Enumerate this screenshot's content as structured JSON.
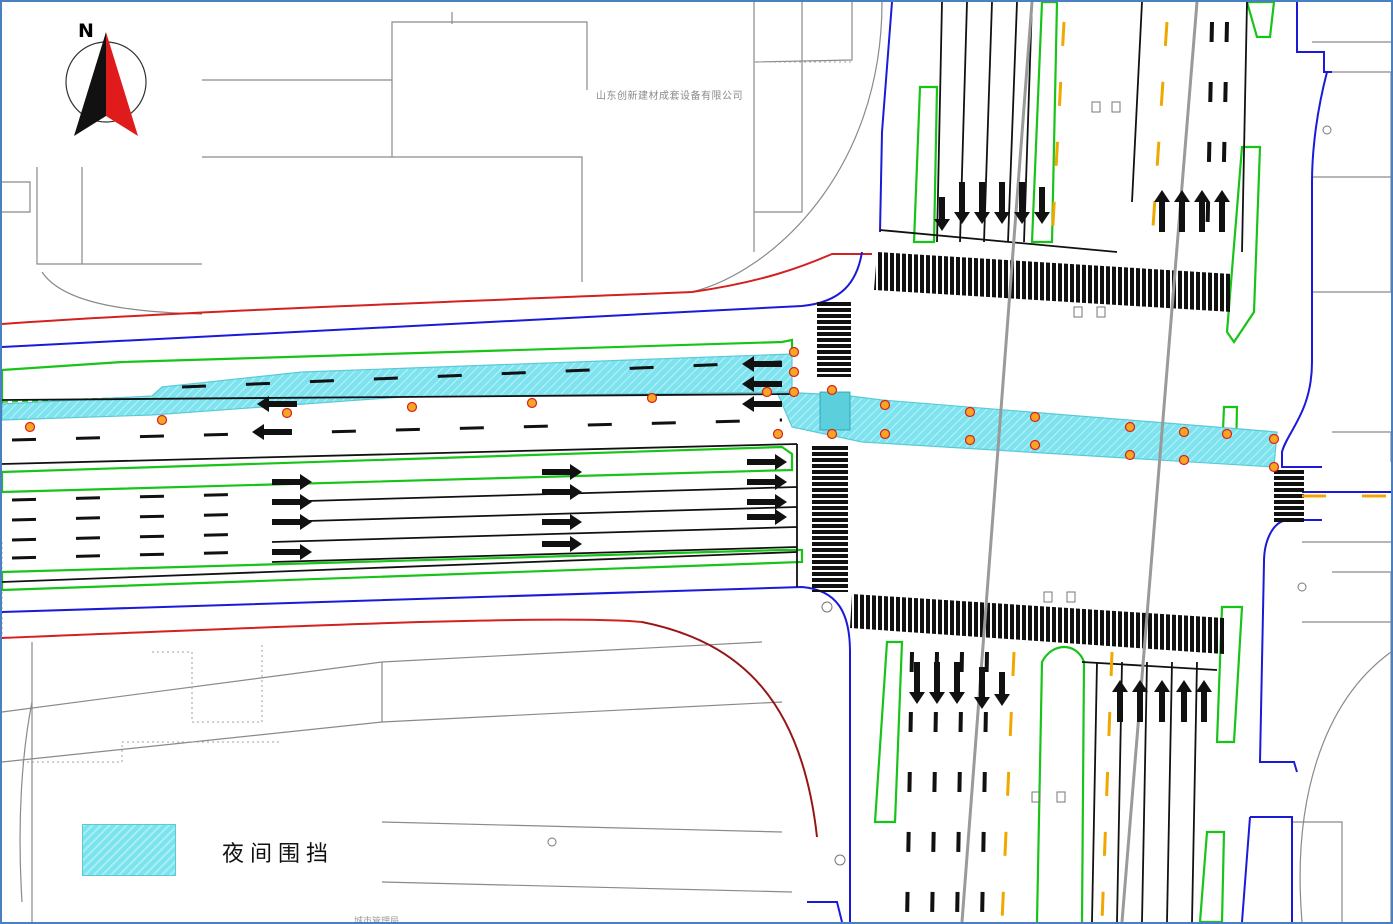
{
  "north_arrow": {
    "label": "N",
    "colors": {
      "left_half": "#111111",
      "right_half": "#e01b1b"
    }
  },
  "map": {
    "company_label": "山东创新建材成套设备有限公司",
    "bottom_label": "……城市管理局……",
    "colors": {
      "road_edge": "#1a1ad8",
      "property_line": "#d42020",
      "green_median": "#19c419",
      "night_barrier": "#7ee3ee",
      "lane_line": "#000000",
      "centerline": "#f0a800",
      "building": "#8a8a8a",
      "marker": "#e07020"
    }
  },
  "legend": {
    "items": [
      {
        "label": "夜间围挡",
        "color": "#79e3ee"
      }
    ]
  }
}
